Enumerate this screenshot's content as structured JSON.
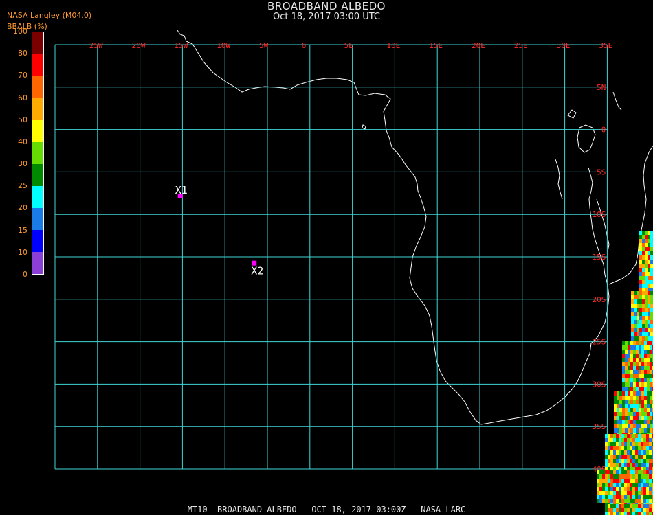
{
  "header": {
    "title": "BROADBAND ALBEDO",
    "subtitle": "Oct 18, 2017 03:00 UTC",
    "source": "NASA Langley (M04.0)",
    "variable": "BBALB (%)"
  },
  "legend": {
    "ticks": [
      "0",
      "10",
      "15",
      "20",
      "25",
      "30",
      "40",
      "50",
      "60",
      "70",
      "80",
      "100"
    ],
    "colors": [
      "#8a3fd6",
      "#0000ff",
      "#1b7be6",
      "#00ffff",
      "#008a00",
      "#66dd00",
      "#ffff00",
      "#ffaa00",
      "#ff6600",
      "#ff0000",
      "#7a0000"
    ]
  },
  "grid": {
    "lon_labels": [
      "25W",
      "20W",
      "15W",
      "10W",
      "5W",
      "0",
      "5E",
      "10E",
      "15E",
      "20E",
      "25E",
      "30E",
      "35E"
    ],
    "lat_labels": [
      "5N",
      "0",
      "5S",
      "10S",
      "15S",
      "20S",
      "25S",
      "30S",
      "35S",
      "40S"
    ],
    "color": "#3fd6d6"
  },
  "markers": [
    {
      "label": "X1",
      "lon": -15.3,
      "lat": -7.8
    },
    {
      "label": "X2",
      "lon": -6.6,
      "lat": -15.7
    }
  ],
  "footer": "MT10  BROADBAND ALBEDO   OCT 18, 2017 03:00Z   NASA LARC"
}
